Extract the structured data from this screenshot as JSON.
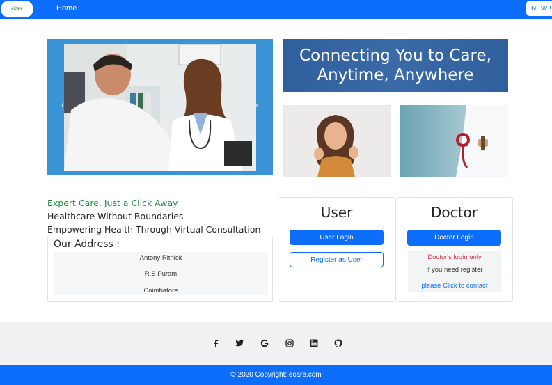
{
  "navbar": {
    "logo_text": "eCare",
    "home_label": "Home",
    "new_label": "NEW !"
  },
  "banner": {
    "line1": "Connecting You to Care,",
    "line2": "Anytime, Anywhere"
  },
  "taglines": {
    "tag1": "Expert Care, Just a Click Away",
    "tag2": "Healthcare Without Boundaries",
    "tag3": "Empowering Health Through Virtual Consultation"
  },
  "address": {
    "title": "Our Address :",
    "lines": [
      "Antony Rithick",
      "R.S Puram",
      "Coimbatore"
    ]
  },
  "user_card": {
    "title": "User",
    "login_label": "User Login",
    "register_label": "Register as User"
  },
  "doctor_card": {
    "title": "Doctor",
    "login_label": "Doctor Login",
    "note": "Doctor's login only",
    "register_text": "if you need register",
    "contact_link": "please Click to contact"
  },
  "social_icons": [
    "facebook-icon",
    "twitter-icon",
    "google-icon",
    "instagram-icon",
    "linkedin-icon",
    "github-icon"
  ],
  "footer": {
    "copyright": "© 2020 Copyright: ecare.com"
  },
  "colors": {
    "primary": "#0d6efd",
    "tagline_green": "#1e8a45",
    "doctor_note_red": "#dc3545",
    "banner_blue": "#2f5f9c"
  }
}
